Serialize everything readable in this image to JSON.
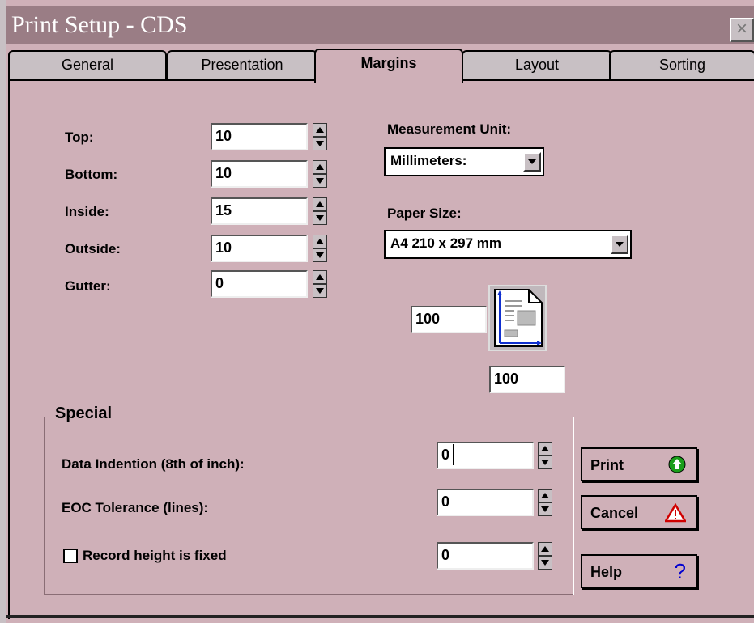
{
  "window": {
    "title": "Print Setup - CDS",
    "close_glyph": "×"
  },
  "tabs": [
    {
      "label": "General"
    },
    {
      "label": "Presentation"
    },
    {
      "label": "Margins"
    },
    {
      "label": "Layout"
    },
    {
      "label": "Sorting"
    }
  ],
  "active_tab": "Margins",
  "margins": {
    "top_label": "Top:",
    "top_value": "10",
    "bottom_label": "Bottom:",
    "bottom_value": "10",
    "inside_label": "Inside:",
    "inside_value": "15",
    "outside_label": "Outside:",
    "outside_value": "10",
    "gutter_label": "Gutter:",
    "gutter_value": "0"
  },
  "measurement": {
    "label": "Measurement Unit:",
    "value": "Millimeters:"
  },
  "paper": {
    "label": "Paper Size:",
    "value": "A4 210 x 297 mm",
    "width_value": "100",
    "height_value": "100"
  },
  "special": {
    "title": "Special",
    "indent_label": "Data Indention (8th of inch):",
    "indent_value": "0",
    "eoc_label": "EOC Tolerance (lines):",
    "eoc_value": "0",
    "record_label": "Record height is fixed",
    "record_checked": false,
    "record_value": "0"
  },
  "buttons": {
    "print": {
      "label": "Print",
      "icon": "green-up-arrow-icon",
      "color": "#1a9e1a"
    },
    "cancel": {
      "label": "Cancel",
      "icon": "warning-triangle-icon",
      "color": "#d00000"
    },
    "help": {
      "label": "Help",
      "icon": "question-mark-icon",
      "color": "#0000d0"
    }
  }
}
